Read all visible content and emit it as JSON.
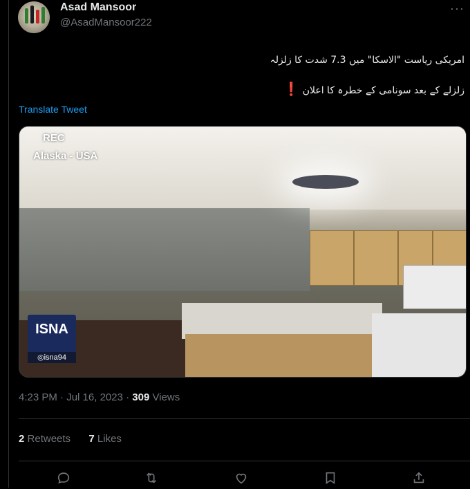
{
  "author": {
    "name": "Asad Mansoor",
    "handle": "@AsadMansoor222"
  },
  "tweet": {
    "line1": "امریکی ریاست \"الاسکا\" میں 7.3 شدت کا زلزلہ",
    "line2": "زلزلے کے بعد سونامی کے خطرہ کا اعلان",
    "line2_marker": "❗",
    "translate_label": "Translate Tweet"
  },
  "media": {
    "rec_label": "REC",
    "location_label": "Alaska - USA",
    "watermark_logo": "ISNA",
    "watermark_handle": "isna94"
  },
  "meta": {
    "time": "4:23 PM",
    "date": "Jul 16, 2023",
    "views_count": "309",
    "views_label": "Views"
  },
  "stats": {
    "retweets_count": "2",
    "retweets_label": "Retweets",
    "likes_count": "7",
    "likes_label": "Likes"
  },
  "actions": [
    "reply-icon",
    "retweet-icon",
    "like-icon",
    "bookmark-icon",
    "share-icon"
  ],
  "colors": {
    "background": "#000000",
    "link": "#1d9bf0",
    "muted": "#71767b",
    "alert": "#f4212e"
  }
}
